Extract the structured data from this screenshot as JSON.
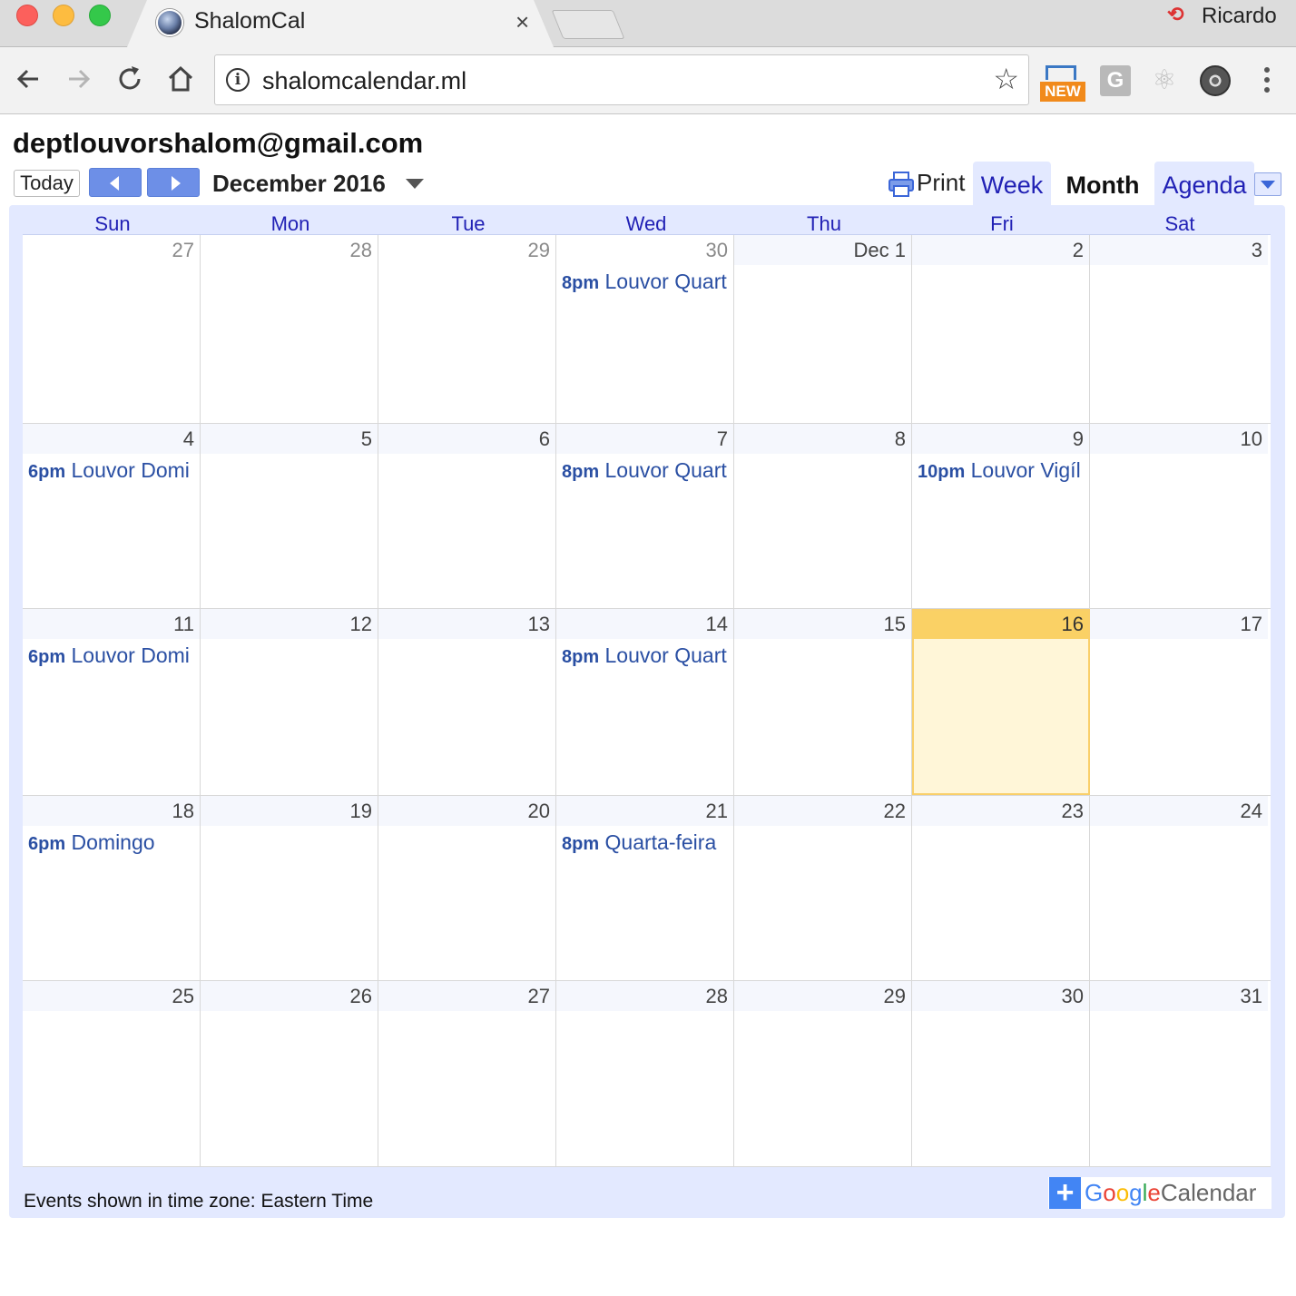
{
  "browser": {
    "tab_title": "ShalomCal",
    "tab_close": "×",
    "profile_name": "Ricardo",
    "url": "shalomcalendar.ml",
    "extension_badge": "NEW",
    "extension_g": "G"
  },
  "header": {
    "account": "deptlouvorshalom@gmail.com",
    "today_label": "Today",
    "month_title": "December 2016",
    "print_label": "Print",
    "views": {
      "week": "Week",
      "month": "Month",
      "agenda": "Agenda"
    }
  },
  "calendar": {
    "weekdays": [
      "Sun",
      "Mon",
      "Tue",
      "Wed",
      "Thu",
      "Fri",
      "Sat"
    ],
    "weeks": [
      [
        {
          "label": "27",
          "other": true
        },
        {
          "label": "28",
          "other": true
        },
        {
          "label": "29",
          "other": true
        },
        {
          "label": "30",
          "other": true,
          "event": {
            "time": "8pm",
            "title": "Louvor Quart"
          }
        },
        {
          "label": "Dec 1"
        },
        {
          "label": "2"
        },
        {
          "label": "3"
        }
      ],
      [
        {
          "label": "4",
          "event": {
            "time": "6pm",
            "title": "Louvor Domi"
          }
        },
        {
          "label": "5"
        },
        {
          "label": "6"
        },
        {
          "label": "7",
          "event": {
            "time": "8pm",
            "title": "Louvor Quart"
          }
        },
        {
          "label": "8"
        },
        {
          "label": "9",
          "event": {
            "time": "10pm",
            "title": "Louvor Vigíl"
          }
        },
        {
          "label": "10"
        }
      ],
      [
        {
          "label": "11",
          "event": {
            "time": "6pm",
            "title": "Louvor Domi"
          }
        },
        {
          "label": "12"
        },
        {
          "label": "13"
        },
        {
          "label": "14",
          "event": {
            "time": "8pm",
            "title": "Louvor Quart"
          }
        },
        {
          "label": "15"
        },
        {
          "label": "16",
          "today": true
        },
        {
          "label": "17"
        }
      ],
      [
        {
          "label": "18",
          "event": {
            "time": "6pm",
            "title": "Domingo"
          }
        },
        {
          "label": "19"
        },
        {
          "label": "20"
        },
        {
          "label": "21",
          "event": {
            "time": "8pm",
            "title": "Quarta-feira"
          }
        },
        {
          "label": "22"
        },
        {
          "label": "23"
        },
        {
          "label": "24"
        }
      ],
      [
        {
          "label": "25"
        },
        {
          "label": "26"
        },
        {
          "label": "27"
        },
        {
          "label": "28"
        },
        {
          "label": "29"
        },
        {
          "label": "30"
        },
        {
          "label": "31"
        }
      ]
    ]
  },
  "footer": {
    "timezone_note": "Events shown in time zone: Eastern Time",
    "brand_plus": "+",
    "brand_google": [
      "G",
      "o",
      "o",
      "g",
      "l",
      "e"
    ],
    "brand_calendar": "Calendar"
  },
  "colors": {
    "event_text": "#2a4fa3",
    "today_header": "#fad165",
    "today_bg": "#fff6d8",
    "frame_bg": "#e3e9ff",
    "nav_button": "#6d8fe7"
  }
}
